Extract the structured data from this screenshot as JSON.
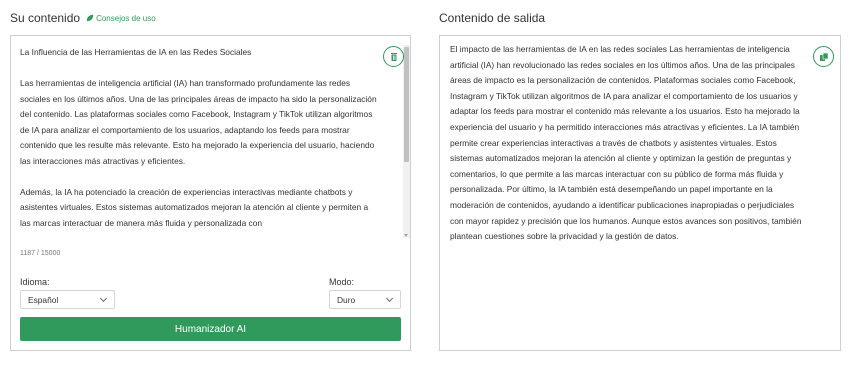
{
  "left": {
    "title": "Su contenido",
    "tips_label": "Consejos de uso",
    "input_text": "La Influencia de las Herramientas de IA en las Redes Sociales\n\nLas herramientas de inteligencia artificial (IA) han transformado profundamente las redes sociales en los últimos años. Una de las principales áreas de impacto ha sido la personalización del contenido. Las plataformas sociales como Facebook, Instagram y TikTok utilizan algoritmos de IA para analizar el comportamiento de los usuarios, adaptando los feeds para mostrar contenido que les resulte más relevante. Esto ha mejorado la experiencia del usuario, haciendo las interacciones más atractivas y eficientes.\n\nAdemás, la IA ha potenciado la creación de experiencias interactivas mediante chatbots y asistentes virtuales. Estos sistemas automatizados mejoran la atención al cliente y permiten a las marcas interactuar de manera más fluida y personalizada con",
    "char_count": "1187 / 15000",
    "language_label": "Idioma:",
    "language_value": "Español",
    "mode_label": "Modo:",
    "mode_value": "Duro",
    "button_label": "Humanizador AI"
  },
  "right": {
    "title": "Contenido de salida",
    "output_text": "El impacto de las herramientas de IA en las redes sociales Las herramientas de inteligencia artificial (IA) han revolucionado las redes sociales en los últimos años. Una de las principales áreas de impacto es la personalización de contenidos. Plataformas sociales como Facebook, Instagram y TikTok utilizan algoritmos de IA para analizar el comportamiento de los usuarios y adaptar los feeds para mostrar el contenido más relevante a los usuarios. Esto ha mejorado la experiencia del usuario y ha permitido interacciones más atractivas y eficientes. La IA también permite crear experiencias interactivas a través de chatbots y asistentes virtuales. Estos sistemas automatizados mejoran la atención al cliente y optimizan la gestión de preguntas y comentarios, lo que permite a las marcas interactuar con su público de forma más fluida y personalizada. Por último, la IA también está desempeñando un papel importante en la moderación de contenidos, ayudando a identificar publicaciones inapropiadas o perjudiciales con mayor rapidez y precisión que los humanos. Aunque estos avances son positivos, también plantean cuestiones sobre la privacidad y la gestión de datos."
  },
  "icons": {
    "tips": "leaf-icon",
    "delete": "trash-icon",
    "copy": "copy-icon",
    "dropdown": "chevron-down-icon"
  },
  "colors": {
    "accent": "#2f9a5b",
    "border": "#cfcfcf"
  }
}
